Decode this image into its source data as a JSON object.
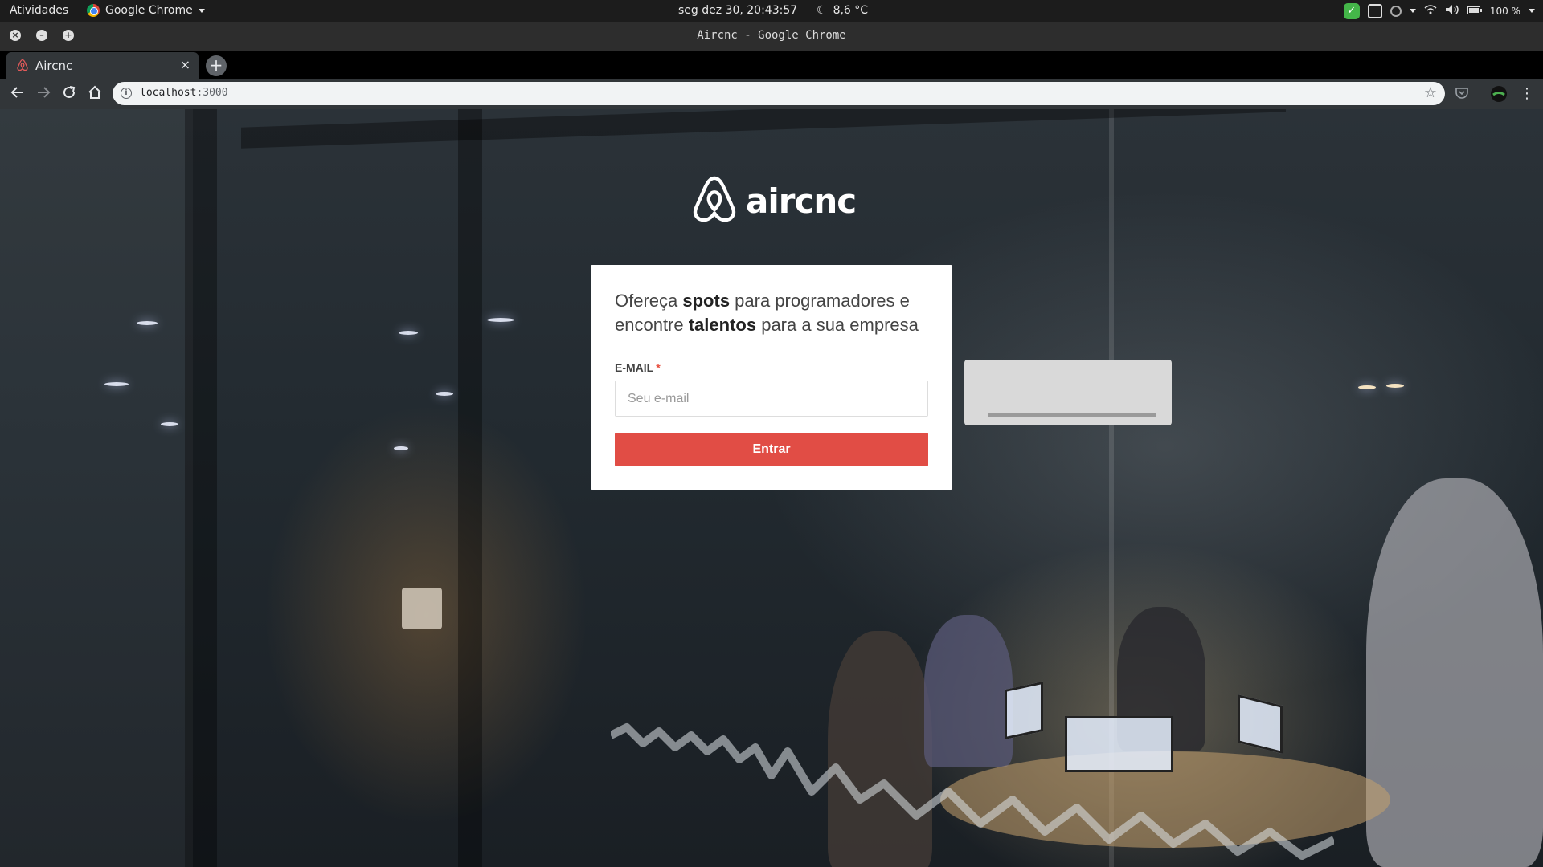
{
  "system_bar": {
    "activities": "Atividades",
    "app_name": "Google Chrome",
    "clock": "seg dez 30, 20:43:57",
    "weather": "8,6 °C",
    "battery": "100 %"
  },
  "window": {
    "title": "Aircnc - Google Chrome"
  },
  "tabs": [
    {
      "label": "Aircnc"
    }
  ],
  "address_bar": {
    "host": "localhost",
    "port": ":3000"
  },
  "page": {
    "logo_text": "aircnc",
    "headline": {
      "part1": "Ofereça ",
      "bold1": "spots",
      "part2": " para programadores e encontre ",
      "bold2": "talentos",
      "part3": " para a sua empresa"
    },
    "email_label": "E-MAIL",
    "email_required_mark": "*",
    "email_placeholder": "Seu e-mail",
    "email_value": "",
    "submit_label": "Entrar"
  },
  "colors": {
    "accent": "#e14d45",
    "tray_check": "#44b649"
  }
}
